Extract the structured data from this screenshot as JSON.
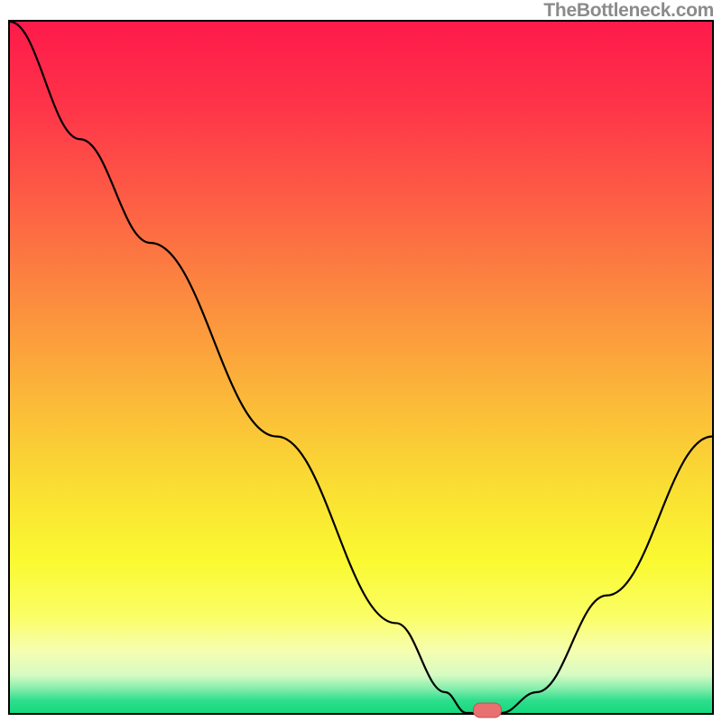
{
  "watermark": "TheBottleneck.com",
  "colors": {
    "gradient_stops": [
      {
        "offset": 0.0,
        "color": "#fe1a4a"
      },
      {
        "offset": 0.12,
        "color": "#fe3349"
      },
      {
        "offset": 0.25,
        "color": "#fd5b45"
      },
      {
        "offset": 0.4,
        "color": "#fc8b3f"
      },
      {
        "offset": 0.55,
        "color": "#fbba39"
      },
      {
        "offset": 0.68,
        "color": "#fae033"
      },
      {
        "offset": 0.78,
        "color": "#faf931"
      },
      {
        "offset": 0.86,
        "color": "#fbfe65"
      },
      {
        "offset": 0.91,
        "color": "#f6feb0"
      },
      {
        "offset": 0.945,
        "color": "#d6fbc3"
      },
      {
        "offset": 0.965,
        "color": "#84edac"
      },
      {
        "offset": 0.982,
        "color": "#2ede8c"
      },
      {
        "offset": 1.0,
        "color": "#14d97e"
      }
    ],
    "curve": "#000000",
    "marker_fill": "#e77070",
    "marker_stroke": "#c85050"
  },
  "chart_data": {
    "type": "line",
    "x_range": [
      0,
      100
    ],
    "y_range": [
      0,
      100
    ],
    "curve_points": [
      {
        "x": 0,
        "y": 100
      },
      {
        "x": 10,
        "y": 83
      },
      {
        "x": 20,
        "y": 68
      },
      {
        "x": 38,
        "y": 40
      },
      {
        "x": 55,
        "y": 13
      },
      {
        "x": 62,
        "y": 3
      },
      {
        "x": 65,
        "y": 0
      },
      {
        "x": 70,
        "y": 0
      },
      {
        "x": 75,
        "y": 3
      },
      {
        "x": 85,
        "y": 17
      },
      {
        "x": 100,
        "y": 40
      }
    ],
    "marker": {
      "x": 68,
      "y": 0
    },
    "title": "",
    "xlabel": "",
    "ylabel": ""
  }
}
